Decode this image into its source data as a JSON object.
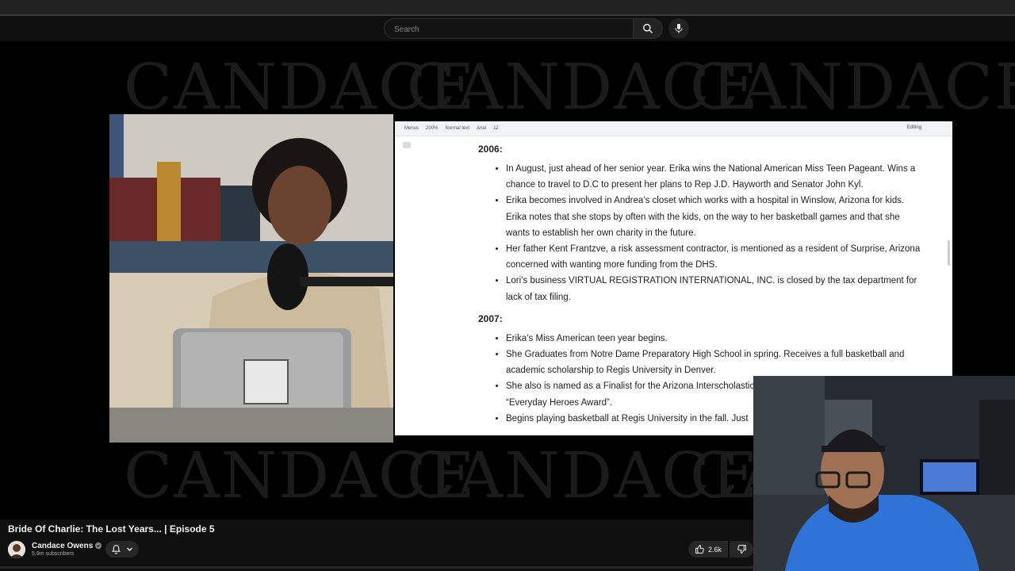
{
  "search": {
    "placeholder": "Search"
  },
  "watermark": {
    "text": "CANDACE"
  },
  "doc": {
    "toolbar": {
      "menus": "Menus",
      "zoom": "200%",
      "style": "Normal text",
      "font": "Arial",
      "size": "12",
      "mode": "Editing"
    },
    "sections": [
      {
        "year": "2006:",
        "items": [
          "In August, just ahead of her senior year. Erika wins the National American Miss Teen Pageant. Wins a chance to travel to D.C to present her plans to Rep J.D. Hayworth and Senator John Kyl.",
          "Erika becomes involved in Andrea’s closet which works with a hospital in Winslow, Arizona for kids.  Erika notes that she stops by often with the kids, on the way to her basketball games and that she wants to establish her own charity in the future.",
          "Her father Kent Frantzve, a risk assessment contractor, is mentioned as a resident of Surprise, Arizona concerned with wanting more funding from the DHS.",
          "Lori’s business VIRTUAL REGISTRATION INTERNATIONAL, INC. is closed by the tax department for lack of tax filing."
        ]
      },
      {
        "year": "2007:",
        "items": [
          "Erika’s Miss American teen year begins.",
          "She Graduates from Notre Dame Preparatory High School in spring. Receives a full basketball and academic scholarship to Regis University in Denver.",
          "She also is named as a Finalist for the Arizona Interscholastic Association's Communications, “Everyday Heroes Award”.",
          "Begins playing basketball at Regis University in the fall. Just"
        ]
      }
    ]
  },
  "video": {
    "title": "Bride Of Charlie: The Lost Years... | Episode 5"
  },
  "channel": {
    "name": "Candace Owens",
    "subscribers": "5.9m subscribers"
  },
  "actions": {
    "likes": "2.6k"
  },
  "icons": [
    "search-icon",
    "mic-icon",
    "verified-icon",
    "bell-icon",
    "chevron-down-icon",
    "thumbs-up-icon",
    "thumbs-down-icon"
  ]
}
